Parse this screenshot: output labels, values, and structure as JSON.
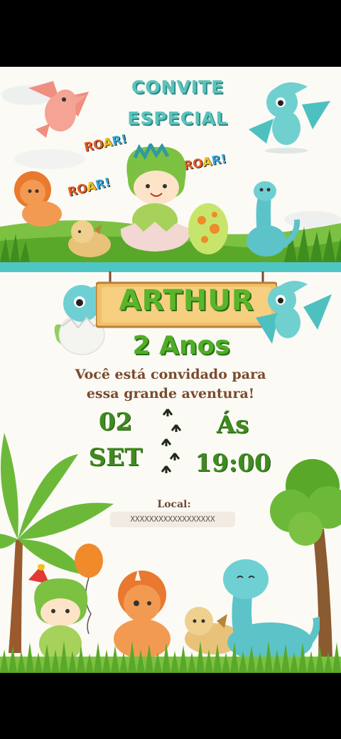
{
  "header": {
    "title_line1": "CONVITE",
    "title_line2": "ESPECIAL",
    "roar1": [
      "RO",
      "A",
      "R!"
    ],
    "roar2": [
      "RO",
      "A",
      "R!"
    ],
    "roar3": [
      "RO",
      "A",
      "R!"
    ]
  },
  "banner": {
    "name": "ARTHUR"
  },
  "age": "2 Anos",
  "invite": {
    "line1": "Você está convidado para",
    "line2": "essa grande aventura!"
  },
  "date": {
    "day": "02",
    "month": "SET"
  },
  "time": {
    "label": "Ás",
    "value": "19:00"
  },
  "location": {
    "label": "Local:",
    "value": "XXXXXXXXXXXXXXXXXX"
  },
  "colors": {
    "teal": "#5cc3bd",
    "green": "#4fad27",
    "brown": "#7b4a2e",
    "orange": "#e8792f",
    "wood": "#f3c06a"
  }
}
